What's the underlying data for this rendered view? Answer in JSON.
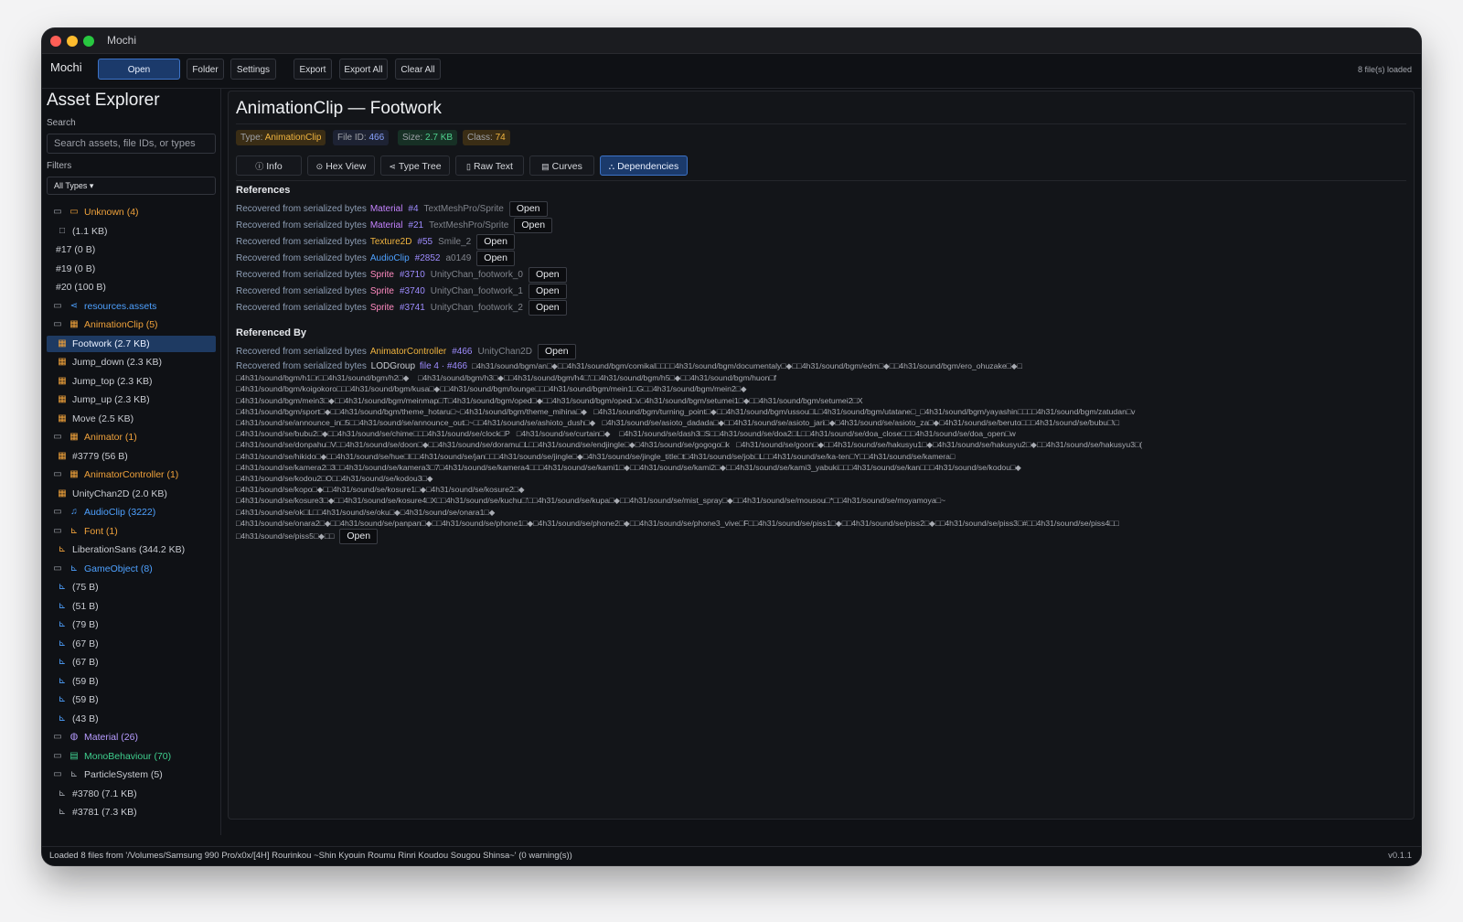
{
  "window": {
    "title": "Mochi"
  },
  "toolbar": {
    "app_name": "Mochi",
    "open": "Open",
    "folder": "Folder",
    "settings": "Settings",
    "export": "Export",
    "export_all": "Export All",
    "clear_all": "Clear All",
    "files_loaded": "8 file(s) loaded"
  },
  "sidebar": {
    "title": "Asset Explorer",
    "search_label": "Search",
    "search_placeholder": "Search assets, file IDs, or types",
    "filters_label": "Filters",
    "filter_value": "All Types ▾",
    "tree": [
      {
        "label": "Unknown (4)",
        "icon": "folder-open-icon",
        "glyph": "▭",
        "color": "orange",
        "indent": 0
      },
      {
        "label": "(1.1 KB)",
        "icon": "file-icon",
        "glyph": "□",
        "color": "gray",
        "indent": 1
      },
      {
        "label": "#17 (0 B)",
        "icon": "",
        "glyph": "",
        "color": "gray",
        "indent": 1
      },
      {
        "label": "#19 (0 B)",
        "icon": "",
        "glyph": "",
        "color": "gray",
        "indent": 1
      },
      {
        "label": "#20 (100 B)",
        "icon": "",
        "glyph": "",
        "color": "gray",
        "indent": 1
      },
      {
        "label": "resources.assets",
        "icon": "share-icon",
        "glyph": "⋖",
        "color": "blue",
        "indent": 0
      },
      {
        "label": "AnimationClip (5)",
        "icon": "film-icon",
        "glyph": "▦",
        "color": "orange",
        "indent": 0
      },
      {
        "label": "Footwork (2.7 KB)",
        "icon": "film-icon",
        "glyph": "▦",
        "color": "orange",
        "indent": 1,
        "selected": true
      },
      {
        "label": "Jump_down (2.3 KB)",
        "icon": "film-icon",
        "glyph": "▦",
        "color": "orange",
        "indent": 1
      },
      {
        "label": "Jump_top (2.3 KB)",
        "icon": "film-icon",
        "glyph": "▦",
        "color": "orange",
        "indent": 1
      },
      {
        "label": "Jump_up (2.3 KB)",
        "icon": "film-icon",
        "glyph": "▦",
        "color": "orange",
        "indent": 1
      },
      {
        "label": "Move (2.5 KB)",
        "icon": "film-icon",
        "glyph": "▦",
        "color": "orange",
        "indent": 1
      },
      {
        "label": "Animator (1)",
        "icon": "film-icon",
        "glyph": "▦",
        "color": "orange",
        "indent": 0
      },
      {
        "label": "#3779 (56 B)",
        "icon": "film-icon",
        "glyph": "▦",
        "color": "orange",
        "indent": 1
      },
      {
        "label": "AnimatorController (1)",
        "icon": "film-icon",
        "glyph": "▦",
        "color": "orange",
        "indent": 0
      },
      {
        "label": "UnityChan2D (2.0 KB)",
        "icon": "film-icon",
        "glyph": "▦",
        "color": "orange",
        "indent": 1
      },
      {
        "label": "AudioClip (3222)",
        "icon": "music-icon",
        "glyph": "♫",
        "color": "blue",
        "indent": 0
      },
      {
        "label": "Font (1)",
        "icon": "chart-icon",
        "glyph": "⊾",
        "color": "orange",
        "indent": 0
      },
      {
        "label": "LiberationSans (344.2 KB)",
        "icon": "chart-icon",
        "glyph": "⊾",
        "color": "orange",
        "indent": 1
      },
      {
        "label": "GameObject (8)",
        "icon": "chart-icon",
        "glyph": "⊾",
        "color": "blue",
        "indent": 0
      },
      {
        "label": "(75 B)",
        "icon": "chart-icon",
        "glyph": "⊾",
        "color": "blue",
        "indent": 1
      },
      {
        "label": "(51 B)",
        "icon": "chart-icon",
        "glyph": "⊾",
        "color": "blue",
        "indent": 1
      },
      {
        "label": "(79 B)",
        "icon": "chart-icon",
        "glyph": "⊾",
        "color": "blue",
        "indent": 1
      },
      {
        "label": "(67 B)",
        "icon": "chart-icon",
        "glyph": "⊾",
        "color": "blue",
        "indent": 1
      },
      {
        "label": "(67 B)",
        "icon": "chart-icon",
        "glyph": "⊾",
        "color": "blue",
        "indent": 1
      },
      {
        "label": "(59 B)",
        "icon": "chart-icon",
        "glyph": "⊾",
        "color": "blue",
        "indent": 1
      },
      {
        "label": "(59 B)",
        "icon": "chart-icon",
        "glyph": "⊾",
        "color": "blue",
        "indent": 1
      },
      {
        "label": "(43 B)",
        "icon": "chart-icon",
        "glyph": "⊾",
        "color": "blue",
        "indent": 1
      },
      {
        "label": "Material (26)",
        "icon": "globe-icon",
        "glyph": "◍",
        "color": "purple",
        "indent": 0
      },
      {
        "label": "MonoBehaviour (70)",
        "icon": "script-icon",
        "glyph": "▤",
        "color": "green",
        "indent": 0
      },
      {
        "label": "ParticleSystem (5)",
        "icon": "chart-icon",
        "glyph": "⊾",
        "color": "gray",
        "indent": 0
      },
      {
        "label": "#3780 (7.1 KB)",
        "icon": "chart-icon",
        "glyph": "⊾",
        "color": "gray",
        "indent": 1
      },
      {
        "label": "#3781 (7.3 KB)",
        "icon": "chart-icon",
        "glyph": "⊾",
        "color": "gray",
        "indent": 1
      }
    ]
  },
  "main": {
    "title": "AnimationClip — Footwork",
    "badges": {
      "type_label": "Type:",
      "type_value": "AnimationClip",
      "fid_label": "File ID:",
      "fid_value": "466",
      "size_label": "Size:",
      "size_value": "2.7 KB",
      "class_label": "Class:",
      "class_value": "74"
    },
    "tabs": [
      {
        "label": "Info",
        "glyph": "ⓘ",
        "icon": "info-icon"
      },
      {
        "label": "Hex View",
        "glyph": "⊙",
        "icon": "hex-icon"
      },
      {
        "label": "Type Tree",
        "glyph": "⋖",
        "icon": "tree-icon"
      },
      {
        "label": "Raw Text",
        "glyph": "▯",
        "icon": "document-icon"
      },
      {
        "label": "Curves",
        "glyph": "▤",
        "icon": "curves-icon"
      },
      {
        "label": "Dependencies",
        "glyph": "⛬",
        "icon": "dependencies-icon",
        "active": true
      }
    ],
    "references_title": "References",
    "references": [
      {
        "source": "Recovered from serialized bytes",
        "class": "Material",
        "kind": "material",
        "pid": "#4",
        "name": "TextMeshPro/Sprite",
        "open": "Open"
      },
      {
        "source": "Recovered from serialized bytes",
        "class": "Material",
        "kind": "material",
        "pid": "#21",
        "name": "TextMeshPro/Sprite",
        "open": "Open"
      },
      {
        "source": "Recovered from serialized bytes",
        "class": "Texture2D",
        "kind": "texture",
        "pid": "#55",
        "name": "Smile_2",
        "open": "Open"
      },
      {
        "source": "Recovered from serialized bytes",
        "class": "AudioClip",
        "kind": "audio",
        "pid": "#2852",
        "name": "a0149",
        "open": "Open"
      },
      {
        "source": "Recovered from serialized bytes",
        "class": "Sprite",
        "kind": "sprite",
        "pid": "#3710",
        "name": "UnityChan_footwork_0",
        "open": "Open"
      },
      {
        "source": "Recovered from serialized bytes",
        "class": "Sprite",
        "kind": "sprite",
        "pid": "#3740",
        "name": "UnityChan_footwork_1",
        "open": "Open"
      },
      {
        "source": "Recovered from serialized bytes",
        "class": "Sprite",
        "kind": "sprite",
        "pid": "#3741",
        "name": "UnityChan_footwork_2",
        "open": "Open"
      }
    ],
    "referenced_by_title": "Referenced By",
    "referenced_by": [
      {
        "source": "Recovered from serialized bytes",
        "class": "AnimatorController",
        "kind": "animator",
        "pid": "#466",
        "name": "UnityChan2D",
        "open": "Open"
      }
    ],
    "lod": {
      "source": "Recovered from serialized bytes",
      "class": "LODGroup",
      "pid": "file 4 · #466",
      "lines": [
        "□4h31/sound/bgm/an□◆□□4h31/sound/bgm/comikal□□□□4h31/sound/bgm/documentaly□◆□□4h31/sound/bgm/edm□◆□□4h31/sound/bgm/ero_ohuzake□◆□",
        "□4h31/sound/bgm/h1□r□□4h31/sound/bgm/h2□◆    □4h31/sound/bgm/h3□◆□□4h31/sound/bgm/h4□'□□4h31/sound/bgm/h5□◆□□4h31/sound/bgm/huon□f",
        "□4h31/sound/bgm/koigokoro□□□4h31/sound/bgm/kusa□◆□□4h31/sound/bgm/lounge□□□4h31/sound/bgm/mein1□G□□4h31/sound/bgm/mein2□◆",
        "□4h31/sound/bgm/mein3□◆□□4h31/sound/bgm/meinmap□T□4h31/sound/bgm/oped□◆□□4h31/sound/bgm/oped□v□4h31/sound/bgm/setumei1□◆□□4h31/sound/bgm/setumei2□X",
        "□4h31/sound/bgm/sport□◆□□4h31/sound/bgm/theme_hotaru□~□4h31/sound/bgm/theme_mihina□◆   □4h31/sound/bgm/turning_point□◆□□4h31/sound/bgm/ussou□L□4h31/sound/bgm/utatane□_□4h31/sound/bgm/yayashin□□□□4h31/sound/bgm/zatudan□v",
        "□4h31/sound/se/announce_in□5□□4h31/sound/se/announce_out□~□□4h31/sound/se/ashioto_dush□◆   □4h31/sound/se/asioto_dadada□◆□□4h31/sound/se/asioto_jari□◆□4h31/sound/se/asioto_za□◆□4h31/sound/se/beruto□□□4h31/sound/se/bubu□\\□",
        "□4h31/sound/se/bubu2□◆□□4h31/sound/se/chime□□□4h31/sound/se/clock□P   □4h31/sound/se/curtain□◆    □4h31/sound/se/dash3□S□□4h31/sound/se/doa2□L□□4h31/sound/se/doa_close□□□4h31/sound/se/doa_open□w",
        "□4h31/sound/se/donpahu□V□□4h31/sound/se/doon□◆□□4h31/sound/se/doramu□L□□4h31/sound/se/endjingle□◆□4h31/sound/se/gogogo□k   □4h31/sound/se/goon□◆□□4h31/sound/se/hakusyu1□◆□4h31/sound/se/hakusyu2□◆□□4h31/sound/se/hakusyu3□(",
        "□4h31/sound/se/hikido□◆□□4h31/sound/se/hue□l□□4h31/sound/se/jan□□□4h31/sound/se/jingle□◆□4h31/sound/se/jingle_title□t□4h31/sound/se/job□L□□4h31/sound/se/ka-ten□Y□□4h31/sound/se/kamera□",
        "□4h31/sound/se/kamera2□3□□4h31/sound/se/kamera3□7□4h31/sound/se/kamera4□□□4h31/sound/se/kami1□◆□□4h31/sound/se/kami2□◆□□4h31/sound/se/kami3_yabuki□□□4h31/sound/se/kan□□□4h31/sound/se/kodou□◆",
        "□4h31/sound/se/kodou2□O□□4h31/sound/se/kodou3□◆",
        "□4h31/sound/se/kopo□◆□□4h31/sound/se/kosure1□◆□4h31/sound/se/kosure2□◆",
        "□4h31/sound/se/kosure3□◆□□4h31/sound/se/kosure4□X□□4h31/sound/se/kuchu□'□□4h31/sound/se/kupa□◆□□4h31/sound/se/mist_spray□◆□□4h31/sound/se/mousou□*□□4h31/sound/se/moyamoya□~",
        "□4h31/sound/se/ok□L□□4h31/sound/se/oku□◆□4h31/sound/se/onara1□◆",
        "□4h31/sound/se/onara2□◆□□4h31/sound/se/panpan□◆□□4h31/sound/se/phone1□◆□4h31/sound/se/phone2□◆□□4h31/sound/se/phone3_vive□F□□4h31/sound/se/piss1□◆□□4h31/sound/se/piss2□◆□□4h31/sound/se/piss3□#□□4h31/sound/se/piss4□□",
        "□4h31/sound/se/piss5□◆□□"
      ],
      "open": "Open"
    }
  },
  "status": {
    "message": "Loaded 8 files from '/Volumes/Samsung 990 Pro/x0x/[4H] Rourinkou ~Shin Kyouin Roumu Rinri Koudou Sougou Shinsa~' (0 warning(s))",
    "version": "v0.1.1"
  }
}
